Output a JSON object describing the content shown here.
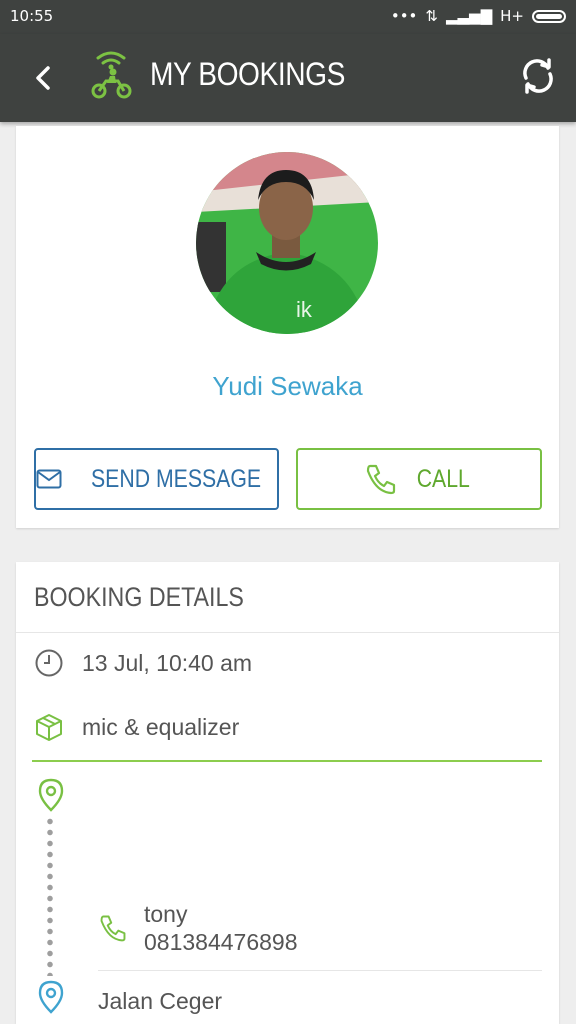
{
  "status_bar": {
    "time": "10:55",
    "network": "H+"
  },
  "app_bar": {
    "title": "MY BOOKINGS"
  },
  "driver": {
    "name": "Yudi Sewaka",
    "send_message_label": "SEND MESSAGE",
    "call_label": "CALL"
  },
  "booking": {
    "section_title": "BOOKING DETAILS",
    "datetime": "13 Jul, 10:40 am",
    "item": "mic & equalizer",
    "contact_name": "tony",
    "contact_phone": "081384476898",
    "destination": "Jalan Ceger"
  },
  "colors": {
    "app_bar": "#3f4240",
    "accent_green": "#79c043",
    "accent_blue": "#2f6fa6",
    "name_blue": "#3fa3cf"
  },
  "icons": [
    "back-arrow-icon",
    "gojek-logo-icon",
    "refresh-icon",
    "envelope-icon",
    "phone-icon",
    "clock-icon",
    "package-icon",
    "pickup-pin-icon",
    "destination-pin-icon"
  ]
}
